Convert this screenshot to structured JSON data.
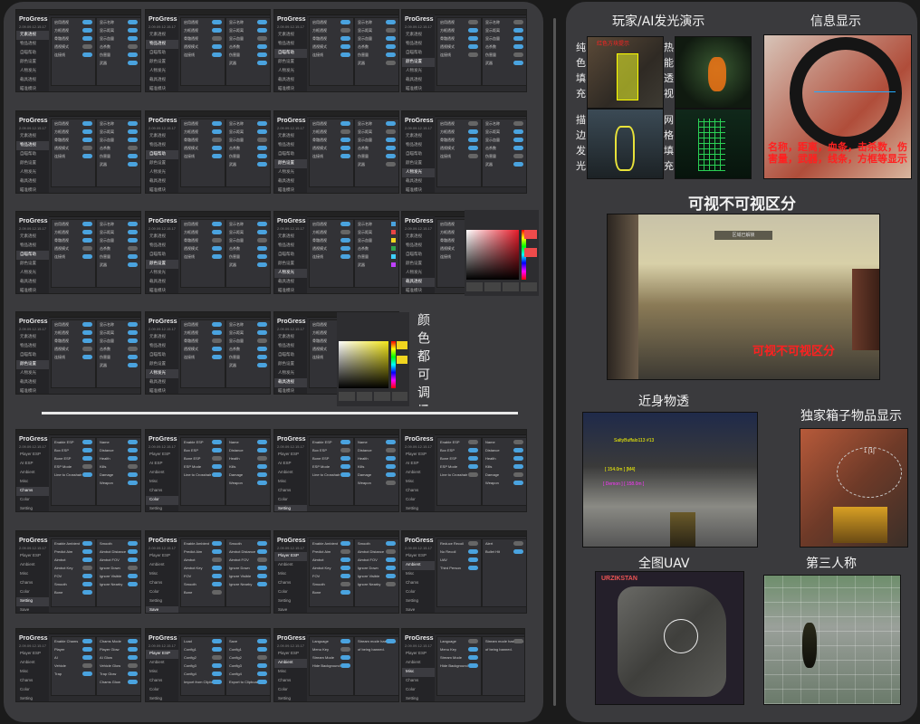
{
  "brand": "ProGress",
  "titlebar": "Insert[Show/Hide]",
  "version": "2.09.09.12.15.17",
  "sidebar_cn": [
    "元素透视",
    "物品透视",
    "自瞄帮助",
    "颜色设置",
    "人物发光",
    "载具透视",
    "瞄准模块",
    "全图雷达",
    "配置管理"
  ],
  "sidebar_en": [
    "Player ESP",
    "AI ESP",
    "Ambient",
    "Misc",
    "Chams",
    "Color",
    "Setting",
    "Save"
  ],
  "sidebar_en_short": [
    "Player ESP",
    "Ambient",
    "Misc",
    "Chams",
    "Color",
    "Setting",
    "Save"
  ],
  "color_annotation": "颜色都可调!",
  "right": {
    "glow_title": "玩家/AI发光演示",
    "info_title": "信息显示",
    "left_vertical_1": "纯色填充",
    "left_vertical_2": "描边发光",
    "right_vertical_1": "热能透视",
    "right_vertical_2": "网格填充",
    "info_overlay": "名称，距离，血条，击杀数，伤害量，武器，线条，方框等显示",
    "visible_title": "可视不可视区分",
    "visible_overlay": "可视不可视区分",
    "near_title": "近身物透",
    "box_title": "独家箱子物品显示",
    "uav_title": "全图UAV",
    "third_title": "第三人称",
    "uav_map_label": "URZIKSTAN",
    "screen_texts": {
      "glow_red": "红色方块提示",
      "zone": "区域已解锁",
      "player_tag": "SaltyBuffalo113 #13",
      "item_1": "[ 154.0m ] [M4]",
      "item_2": "[ Demon ] [ 158.0m ]",
      "box_num": "1 [1]"
    }
  },
  "menus": {
    "esp_labels": [
      "Enable ESP",
      "Box ESP",
      "Bone ESP",
      "ESP Mode",
      "Line to Crosshair"
    ],
    "display_labels": [
      "Name",
      "Distance",
      "Health",
      "Kills",
      "Damage",
      "Weapon"
    ],
    "ambient_labels": [
      "Enable Ambient",
      "Predict Aim",
      "Aimbot",
      "Aimbot Key",
      "FOV",
      "Smooth",
      "Bone"
    ],
    "setting_labels": [
      "Smooth",
      "Aimbot Distance",
      "Aimbot FOV",
      "Ignore Down",
      "Ignore Visible",
      "Ignore Nearby"
    ],
    "misc_labels": [
      "Reduce Recoil",
      "No Recoil",
      "UAV",
      "Third Person"
    ],
    "display2_labels": [
      "Alert",
      "Bullet Hit"
    ],
    "chams_labels": [
      "Enable Chams",
      "Player",
      "AI",
      "Vehicle",
      "Trap"
    ],
    "chams_option_labels": [
      "Chams Mode",
      "Player Glow",
      "AI Glow",
      "Vehicle Glow",
      "Trap Glow",
      "Chams Glow"
    ],
    "load_labels": [
      "Load",
      "Config1",
      "Config2",
      "Config3",
      "Config4",
      "Import from Clipboard"
    ],
    "save_labels": [
      "Save",
      "Config1",
      "Config2",
      "Config3",
      "Config4",
      "Export to Clipboard"
    ],
    "setting_labels2": [
      "Language",
      "Menu Key",
      "Stream Mode",
      "Hide Background"
    ],
    "about_text": "Stream mode has a risk of being banned.",
    "esp_mode_value": "Full ESP",
    "language_value": "English",
    "cn_rows_a": [
      "启用透视",
      "方框透视",
      "骨骼透视",
      "透视模式",
      "连接线"
    ],
    "cn_rows_b": [
      "显示名称",
      "显示距离",
      "显示血量",
      "击杀数",
      "伤害量",
      "武器"
    ]
  }
}
